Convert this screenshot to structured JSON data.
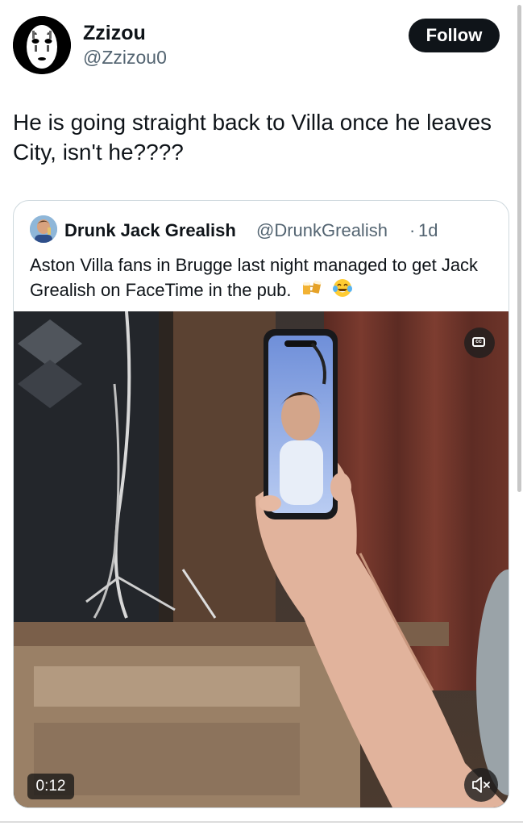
{
  "tweet": {
    "display_name": "Zzizou",
    "handle": "@Zzizou0",
    "follow_label": "Follow",
    "text": "He is going straight back to Villa once he leaves City, isn't he????"
  },
  "quoted": {
    "display_name": "Drunk Jack Grealish",
    "handle": "@DrunkGrealish",
    "separator": "·",
    "time": "1d",
    "text": "Aston Villa fans in Brugge last night managed to get Jack Grealish on FaceTime in the pub.",
    "emojis": [
      "beer-mugs",
      "face-with-tears-of-joy"
    ]
  },
  "video": {
    "timestamp": "0:12",
    "captions_icon": "cc-icon",
    "mute_icon": "muted-speaker-icon"
  },
  "colors": {
    "text": "#0f1419",
    "secondary": "#536471",
    "follow_bg": "#0f1419",
    "border": "#cfd9de"
  }
}
